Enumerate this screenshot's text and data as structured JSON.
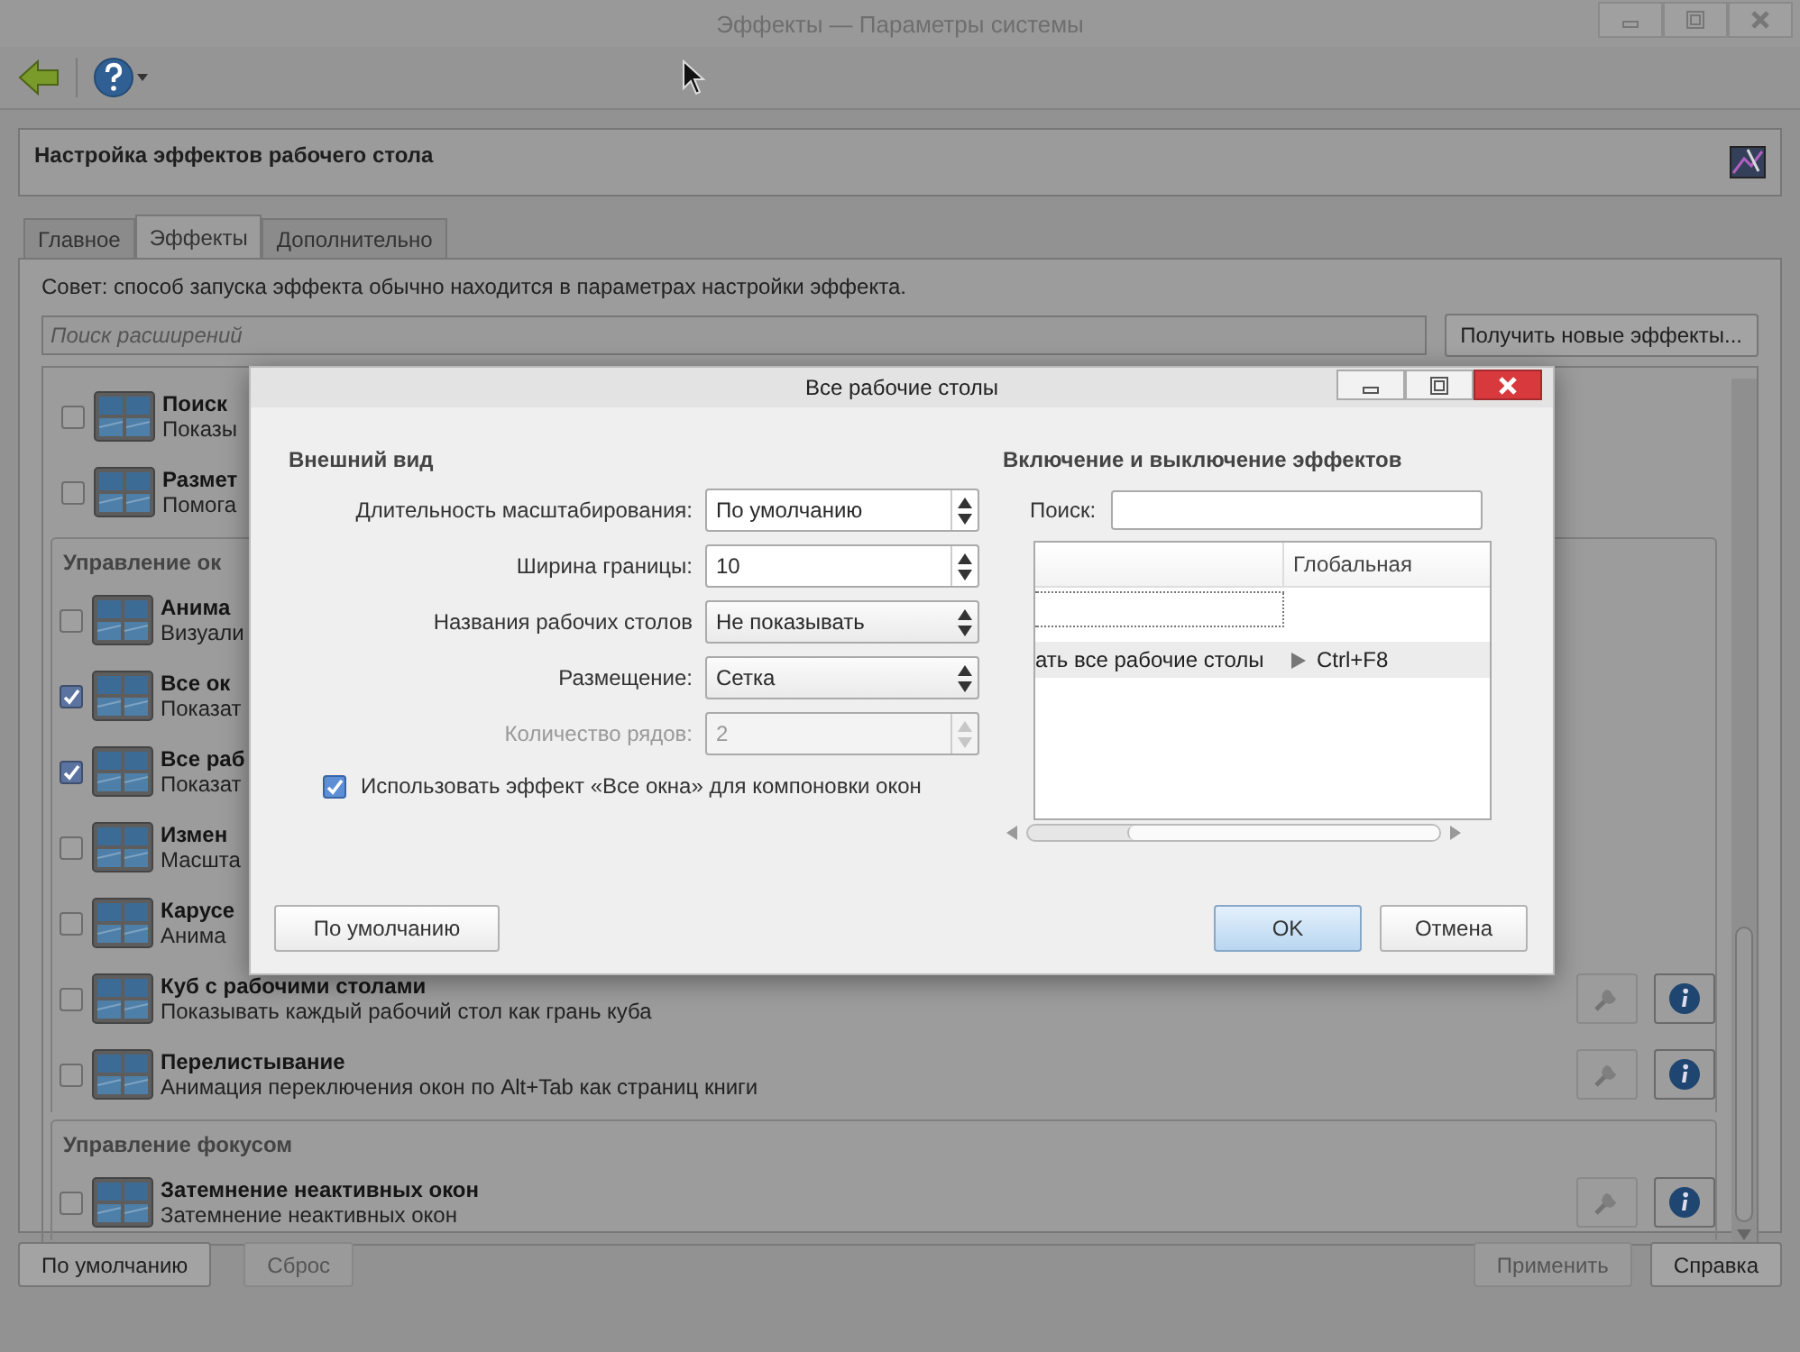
{
  "window": {
    "title": "Эффекты — Параметры системы",
    "controls": [
      {
        "kind": "minimize"
      },
      {
        "kind": "maximize"
      },
      {
        "kind": "close"
      }
    ]
  },
  "header": {
    "title": "Настройка эффектов рабочего стола"
  },
  "tabs": [
    {
      "label": "Главное",
      "selected": false
    },
    {
      "label": "Эффекты",
      "selected": true
    },
    {
      "label": "Дополнительно",
      "selected": false
    }
  ],
  "tip": "Совет: способ запуска эффекта обычно находится в параметрах настройки эффекта.",
  "search": {
    "placeholder": "Поиск расширений"
  },
  "get_new_button": "Получить новые эффекты...",
  "groups": [
    {
      "items": [
        {
          "title": "Поиск",
          "description": "Показы",
          "checked": false
        },
        {
          "title": "Размет",
          "description": "Помога",
          "checked": false
        }
      ]
    },
    {
      "header": "Управление ок",
      "items": [
        {
          "title": "Анима",
          "description": "Визуали",
          "checked": false
        },
        {
          "title": "Все ок",
          "description": "Показат",
          "checked": true
        },
        {
          "title": "Все раб",
          "description": "Показат",
          "checked": true
        },
        {
          "title": "Измен",
          "description": "Масшта",
          "checked": false
        },
        {
          "title": "Карусе",
          "description": "Анима",
          "checked": false
        },
        {
          "title": "Куб с рабочими столами",
          "description": "Показывать каждый рабочий стол как грань куба",
          "checked": false,
          "tools": {
            "configure_disabled": true
          }
        },
        {
          "title": "Перелистывание",
          "description": "Анимация переключения окон по Alt+Tab как страниц книги",
          "checked": false,
          "tools": {
            "configure_disabled": true
          }
        }
      ]
    },
    {
      "header": "Управление фокусом",
      "items": [
        {
          "title": "Затемнение неактивных окон",
          "description": "Затемнение неактивных окон",
          "checked": false,
          "tools": {
            "configure_disabled": true
          }
        }
      ]
    }
  ],
  "bottom_buttons": [
    {
      "label": "По умолчанию",
      "disabled": false
    },
    {
      "label": "Сброс",
      "disabled": true
    },
    {
      "label": "Применить",
      "disabled": true
    },
    {
      "label": "Справка",
      "disabled": false
    }
  ],
  "dialog": {
    "title": "Все рабочие столы",
    "controls": [
      {
        "kind": "minimize"
      },
      {
        "kind": "maximize"
      },
      {
        "kind": "close"
      }
    ],
    "appearance": {
      "heading": "Внешний вид",
      "fields": [
        {
          "label": "Длительность масштабирования:",
          "value": "По умолчанию",
          "kind": "spin",
          "disabled": false
        },
        {
          "label": "Ширина границы:",
          "value": "10",
          "kind": "spin",
          "disabled": false
        },
        {
          "label": "Названия рабочих столов",
          "value": "Не показывать",
          "kind": "combo",
          "disabled": false
        },
        {
          "label": "Размещение:",
          "value": "Сетка",
          "kind": "combo",
          "disabled": false
        },
        {
          "label": "Количество рядов:",
          "value": "2",
          "kind": "spin",
          "disabled": true
        }
      ],
      "checkbox": {
        "label": "Использовать эффект «Все окна» для компоновки окон",
        "checked": true
      }
    },
    "shortcuts": {
      "heading": "Включение и выключение эффектов",
      "search_label": "Поиск:",
      "columns": [
        "Глобальная"
      ],
      "rows": [
        {
          "focused": true,
          "selected": false
        },
        {
          "action": "ать все рабочие столы",
          "shortcut": "Ctrl+F8",
          "focused": false,
          "selected": true
        }
      ]
    },
    "buttons": [
      {
        "label": "По умолчанию",
        "default": false
      },
      {
        "label": "OK",
        "default": true
      },
      {
        "label": "Отмена",
        "default": false
      }
    ]
  }
}
